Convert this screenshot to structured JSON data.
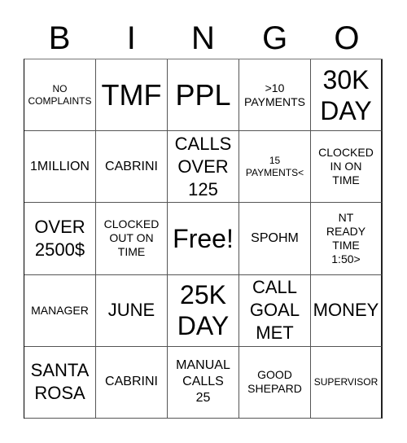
{
  "header": {
    "letters": [
      "B",
      "I",
      "N",
      "G",
      "O"
    ]
  },
  "cells": [
    {
      "text": "NO\nCOMPLAINTS",
      "size": "xs"
    },
    {
      "text": "TMF",
      "size": "xxl"
    },
    {
      "text": "PPL",
      "size": "xxl"
    },
    {
      "text": ">10\nPAYMENTS",
      "size": "sm"
    },
    {
      "text": "30K\nDAY",
      "size": "xl"
    },
    {
      "text": "1MILLION",
      "size": "md"
    },
    {
      "text": "CABRINI",
      "size": "md"
    },
    {
      "text": "CALLS\nOVER\n125",
      "size": "lg"
    },
    {
      "text": "15\nPAYMENTS<",
      "size": "xs"
    },
    {
      "text": "CLOCKED\nIN ON\nTIME",
      "size": "sm"
    },
    {
      "text": "OVER\n2500$",
      "size": "lg"
    },
    {
      "text": "CLOCKED\nOUT ON\nTIME",
      "size": "sm"
    },
    {
      "text": "Free!",
      "size": "xl",
      "free": true
    },
    {
      "text": "SPOHM",
      "size": "md"
    },
    {
      "text": "NT\nREADY\nTIME\n1:50>",
      "size": "sm"
    },
    {
      "text": "MANAGER",
      "size": "sm"
    },
    {
      "text": "JUNE",
      "size": "lg"
    },
    {
      "text": "25K\nDAY",
      "size": "xl"
    },
    {
      "text": "CALL\nGOAL\nMET",
      "size": "lg"
    },
    {
      "text": "MONEY",
      "size": "lg"
    },
    {
      "text": "SANTA\nROSA",
      "size": "lg"
    },
    {
      "text": "CABRINI",
      "size": "md"
    },
    {
      "text": "MANUAL\nCALLS\n25",
      "size": "md"
    },
    {
      "text": "GOOD\nSHEPARD",
      "size": "sm"
    },
    {
      "text": "SUPERVISOR",
      "size": "xs"
    }
  ]
}
